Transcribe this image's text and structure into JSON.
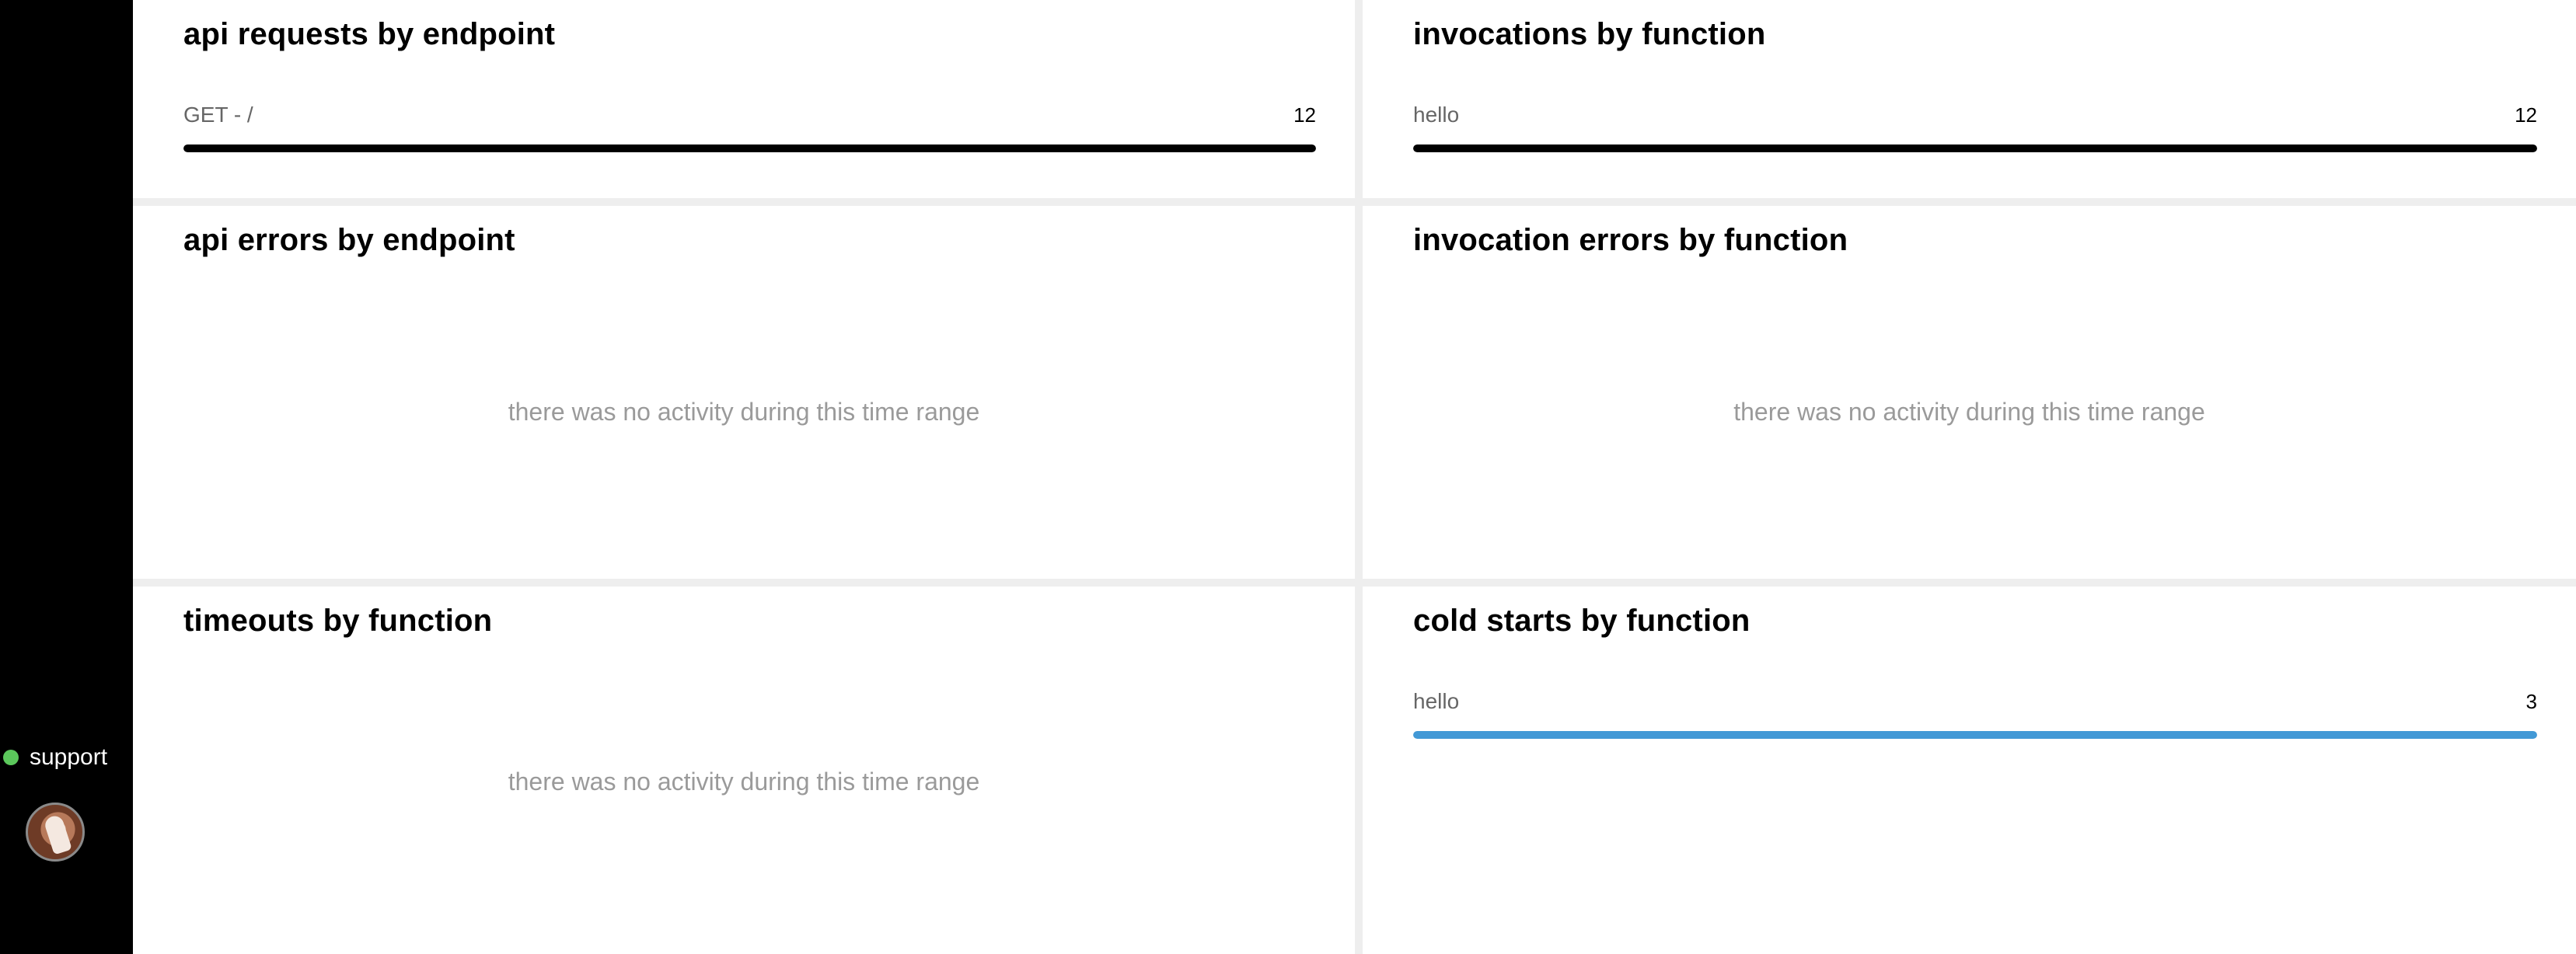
{
  "sidebar": {
    "support_label": "support",
    "status_color": "#5cc85c"
  },
  "panels": {
    "api_requests": {
      "title": "api requests by endpoint",
      "rows": [
        {
          "label": "GET - /",
          "value": "12",
          "fraction": 1.0,
          "color": "#000000"
        }
      ]
    },
    "invocations": {
      "title": "invocations by function",
      "rows": [
        {
          "label": "hello",
          "value": "12",
          "fraction": 1.0,
          "color": "#000000"
        }
      ]
    },
    "api_errors": {
      "title": "api errors by endpoint",
      "empty_message": "there was no activity during this time range"
    },
    "invocation_errors": {
      "title": "invocation errors by function",
      "empty_message": "there was no activity during this time range"
    },
    "timeouts": {
      "title": "timeouts by function",
      "empty_message": "there was no activity during this time range"
    },
    "cold_starts": {
      "title": "cold starts by function",
      "rows": [
        {
          "label": "hello",
          "value": "3",
          "fraction": 1.0,
          "color": "#4299d6"
        }
      ]
    }
  }
}
